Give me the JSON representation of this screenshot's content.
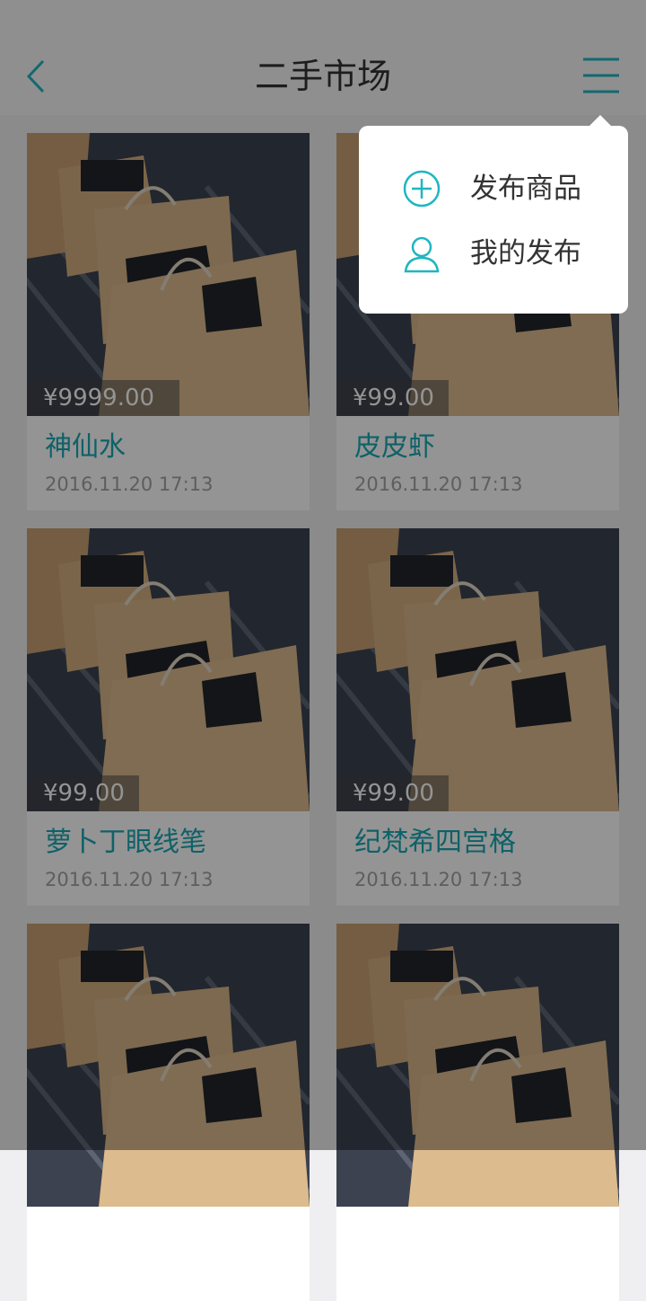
{
  "header": {
    "title": "二手市场",
    "back_icon": "chevron-left-icon",
    "menu_icon": "menu-lines-icon"
  },
  "colors": {
    "accent": "#1fb6c1",
    "name_text": "#1aa7b3",
    "time_text": "#a3a3a3",
    "price_text": "#ffffff",
    "dim_overlay": "rgba(0,0,0,0.42)"
  },
  "products": [
    {
      "price": "¥9999.00",
      "name": "神仙水",
      "time": "2016.11.20 17:13"
    },
    {
      "price": "¥99.00",
      "name": "皮皮虾",
      "time": "2016.11.20 17:13"
    },
    {
      "price": "¥99.00",
      "name": "萝卜丁眼线笔",
      "time": "2016.11.20 17:13"
    },
    {
      "price": "¥99.00",
      "name": "纪梵希四宫格",
      "time": "2016.11.20 17:13"
    },
    {
      "price": "",
      "name": "",
      "time": ""
    },
    {
      "price": "",
      "name": "",
      "time": ""
    }
  ],
  "popup_menu": {
    "items": [
      {
        "label": "发布商品",
        "icon": "plus-circle-icon"
      },
      {
        "label": "我的发布",
        "icon": "user-icon"
      }
    ]
  }
}
